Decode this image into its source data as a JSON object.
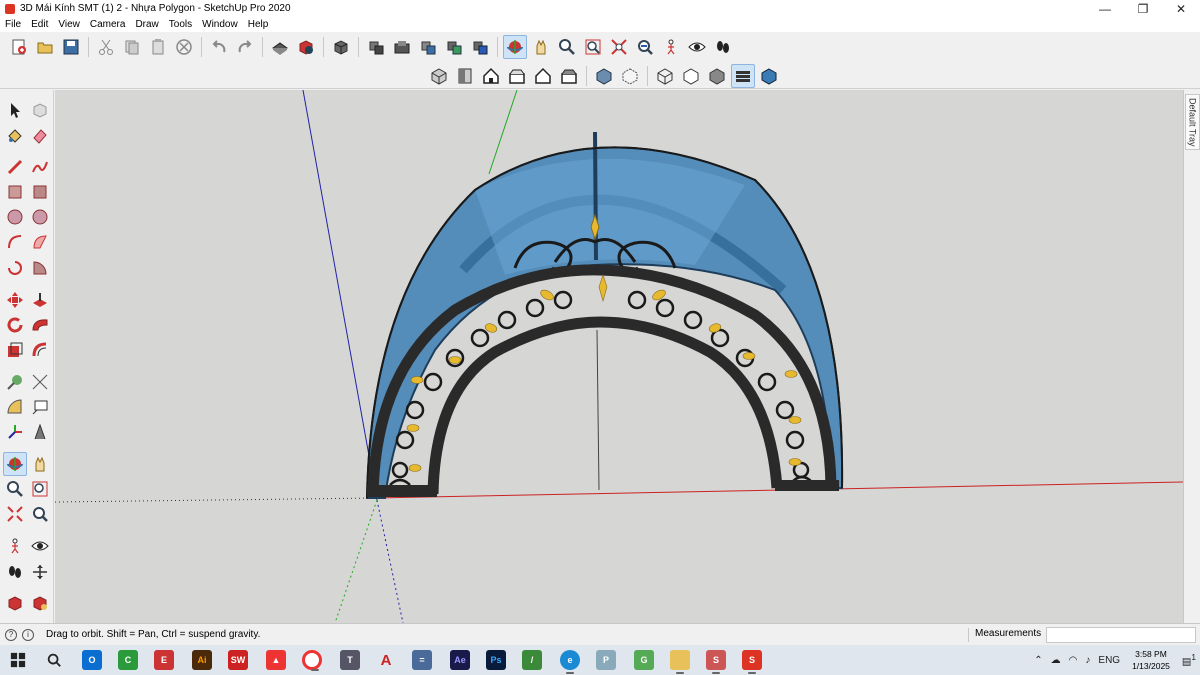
{
  "window": {
    "title": "3D Mái Kính SMT (1) 2 - Nhựa Polygon - SketchUp Pro 2020",
    "minimize": "—",
    "maximize": "❐",
    "close": "✕"
  },
  "menu": [
    "File",
    "Edit",
    "View",
    "Camera",
    "Draw",
    "Tools",
    "Window",
    "Help"
  ],
  "toolbar1": {
    "groups": [
      [
        "new-file",
        "open-file",
        "save-file"
      ],
      [
        "cut",
        "copy",
        "paste",
        "erase-selection"
      ],
      [
        "undo",
        "redo"
      ],
      [
        "print",
        "model-info"
      ],
      [
        "make-component"
      ],
      [
        "component-a",
        "component-b",
        "component-c",
        "component-d",
        "component-e"
      ],
      [
        "orbit",
        "pan",
        "zoom",
        "zoom-window",
        "zoom-extents",
        "previous-view",
        "position-camera",
        "look-around",
        "walk"
      ]
    ],
    "active": "orbit"
  },
  "toolbar2": {
    "views": [
      "iso-view",
      "top-view",
      "front-view",
      "right-view",
      "back-view",
      "left-view"
    ],
    "styles": [
      "xray",
      "back-edges",
      "wireframe",
      "hidden-line",
      "shaded",
      "shaded-textures",
      "monochrome"
    ],
    "active": "shaded-textures"
  },
  "left_tools": {
    "active": "orbit"
  },
  "tray": {
    "label": "Default Tray"
  },
  "status": {
    "text": "Drag to orbit. Shift = Pan, Ctrl = suspend gravity.",
    "measurements_label": "Measurements",
    "measurements_value": ""
  },
  "taskbar": {
    "apps": [
      "start",
      "search",
      "outlook",
      "camtasia",
      "edraw",
      "illustrator",
      "solidworks",
      "drawing",
      "chrome",
      "tool",
      "acrobat",
      "calculator",
      "after-effects",
      "photoshop",
      "pen",
      "edge",
      "paint",
      "greenshot",
      "explorer",
      "snipping",
      "sketchup"
    ],
    "tray": {
      "language": "ENG",
      "time": "3:58 PM",
      "date": "1/13/2025",
      "notifications": "1"
    }
  },
  "colors": {
    "viewport_bg": "#d6d6d4",
    "glass": "#3d7fb5",
    "iron": "#2a2a2a",
    "gold": "#e7b92e",
    "axis_red": "#c22",
    "axis_green": "#2a2",
    "axis_blue": "#22a"
  }
}
